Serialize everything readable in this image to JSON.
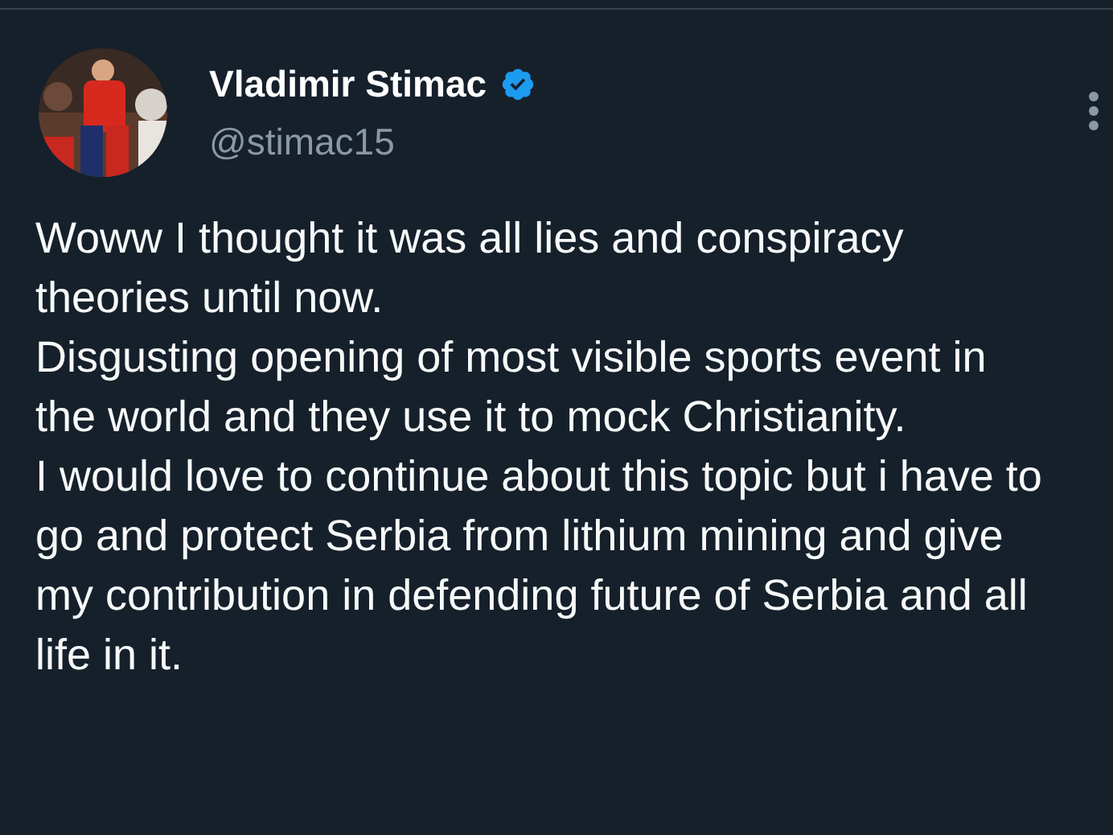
{
  "author": {
    "name": "Vladimir Stimac",
    "verified": true,
    "handle": "@stimac15"
  },
  "tweet": {
    "paragraphs": [
      "Woww I thought it was all lies and conspiracy theories until now.",
      "Disgusting opening of most visible sports event in the world and they use it to mock Christianity.",
      "I would love to continue about this topic but i have to go and protect Serbia from lithium mining and give my contribution in defending future of Serbia and all life in it."
    ]
  }
}
